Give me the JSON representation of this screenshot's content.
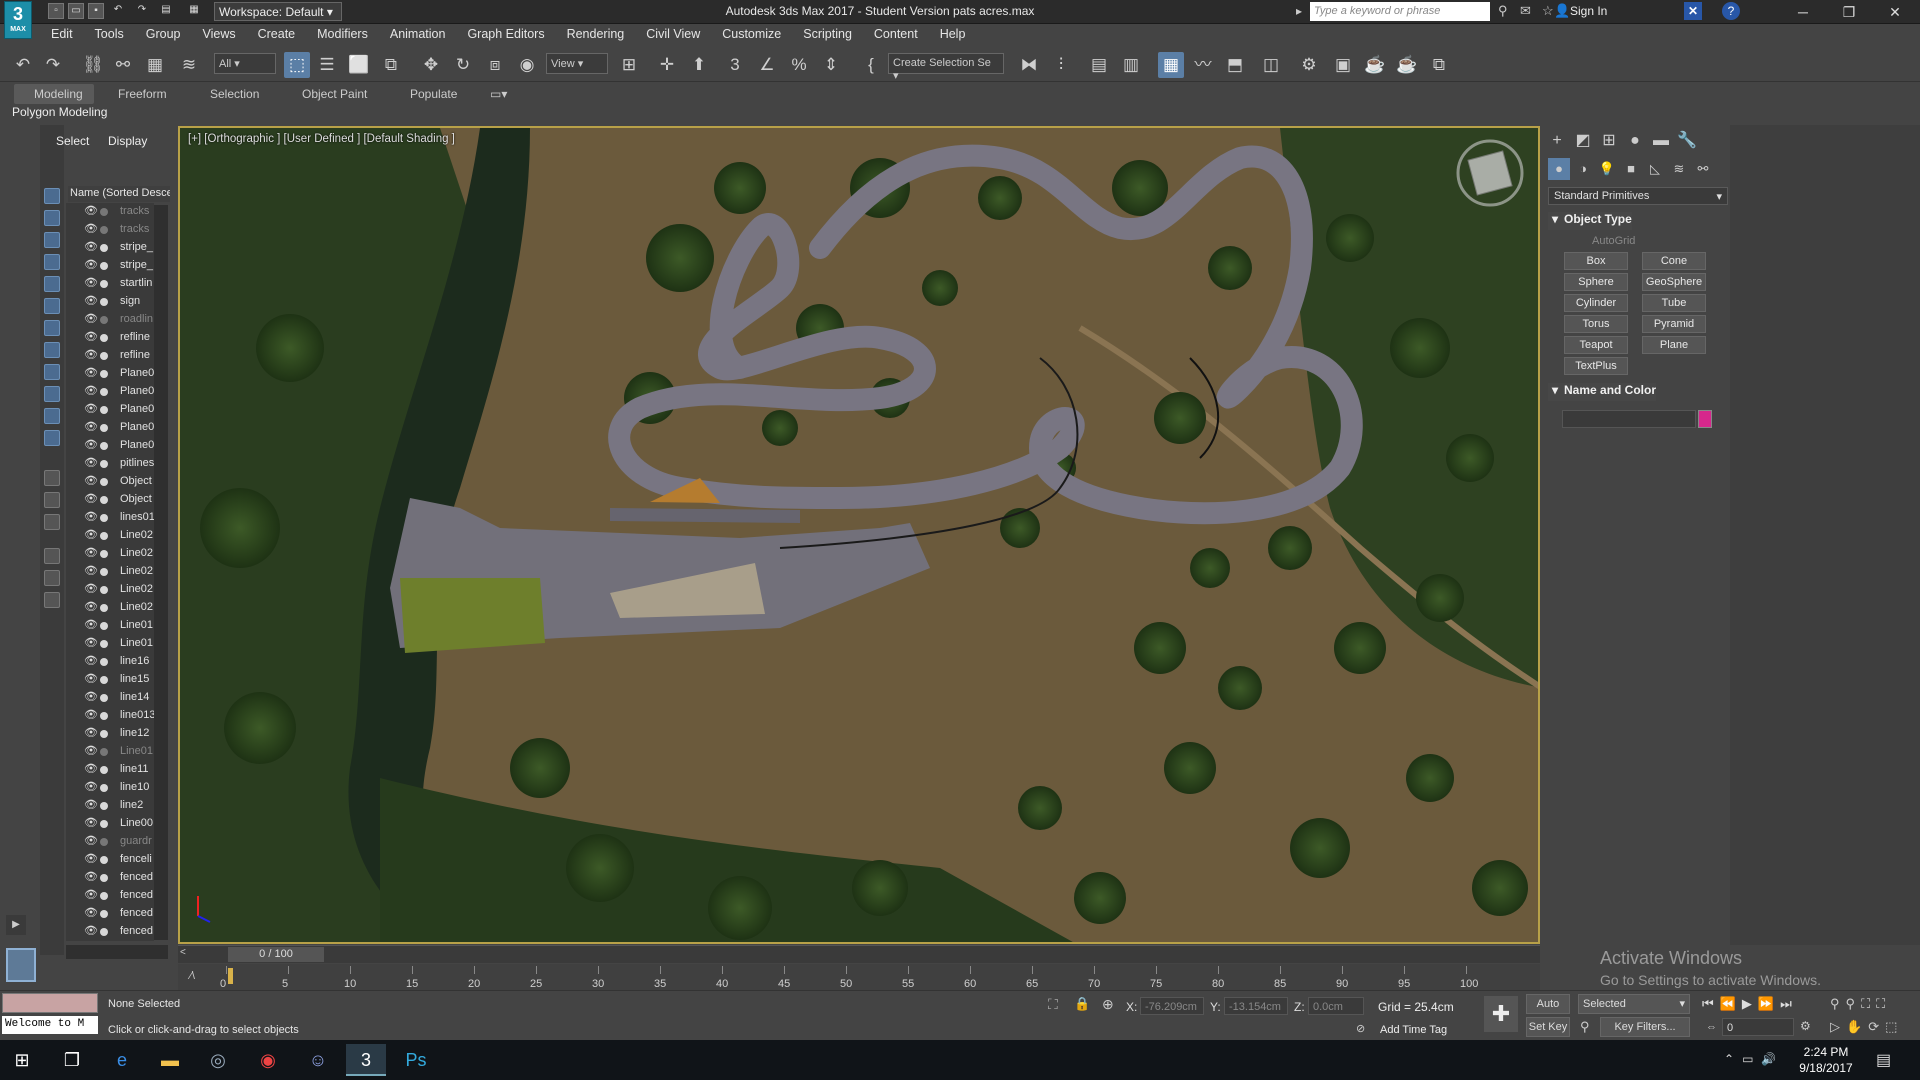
{
  "title_bar": {
    "logo_text": "3",
    "logo_sub": "MAX",
    "workspace": "Workspace: Default",
    "window_title": "Autodesk 3ds Max 2017 - Student Version    pats acres.max",
    "search_placeholder": "Type a keyword or phrase",
    "sign_in": "Sign In",
    "help": "?"
  },
  "menu": [
    "Edit",
    "Tools",
    "Group",
    "Views",
    "Create",
    "Modifiers",
    "Animation",
    "Graph Editors",
    "Rendering",
    "Civil View",
    "Customize",
    "Scripting",
    "Content",
    "Help"
  ],
  "toolbar": {
    "selection_filter": "All",
    "ref_coord": "View",
    "named_selection": "Create Selection Se"
  },
  "ribbon": {
    "tabs": [
      "Modeling",
      "Freeform",
      "Selection",
      "Object Paint",
      "Populate"
    ],
    "active": "Modeling",
    "sub_label": "Polygon Modeling"
  },
  "scene_explorer": {
    "tabs": [
      "Select",
      "Display"
    ],
    "column_header": "Name (Sorted Descen",
    "rows": [
      {
        "name": "tracks",
        "dim": true
      },
      {
        "name": "tracks",
        "dim": true
      },
      {
        "name": "stripe_",
        "dim": false
      },
      {
        "name": "stripe_",
        "dim": false
      },
      {
        "name": "startlin",
        "dim": false
      },
      {
        "name": "sign",
        "dim": false
      },
      {
        "name": "roadlin",
        "dim": true
      },
      {
        "name": "refline",
        "dim": false
      },
      {
        "name": "refline",
        "dim": false
      },
      {
        "name": "Plane0",
        "dim": false
      },
      {
        "name": "Plane0",
        "dim": false
      },
      {
        "name": "Plane0",
        "dim": false
      },
      {
        "name": "Plane0",
        "dim": false
      },
      {
        "name": "Plane0",
        "dim": false
      },
      {
        "name": "pitlines",
        "dim": false
      },
      {
        "name": "Object",
        "dim": false
      },
      {
        "name": "Object",
        "dim": false
      },
      {
        "name": "lines01",
        "dim": false
      },
      {
        "name": "Line02",
        "dim": false
      },
      {
        "name": "Line02",
        "dim": false
      },
      {
        "name": "Line02",
        "dim": false
      },
      {
        "name": "Line02",
        "dim": false
      },
      {
        "name": "Line02",
        "dim": false
      },
      {
        "name": "Line01",
        "dim": false
      },
      {
        "name": "Line01",
        "dim": false
      },
      {
        "name": "line16",
        "dim": false
      },
      {
        "name": "line15",
        "dim": false
      },
      {
        "name": "line14",
        "dim": false
      },
      {
        "name": "line013",
        "dim": false
      },
      {
        "name": "line12",
        "dim": false
      },
      {
        "name": "Line01",
        "dim": true
      },
      {
        "name": "line11",
        "dim": false
      },
      {
        "name": "line10",
        "dim": false
      },
      {
        "name": "line2",
        "dim": false
      },
      {
        "name": "Line00",
        "dim": false
      },
      {
        "name": "guardr",
        "dim": true
      },
      {
        "name": "fenceli",
        "dim": false
      },
      {
        "name": "fenced",
        "dim": false
      },
      {
        "name": "fenced",
        "dim": false
      },
      {
        "name": "fenced",
        "dim": false
      },
      {
        "name": "fenced",
        "dim": false
      }
    ]
  },
  "viewport": {
    "label": "[+] [Orthographic ] [User Defined ] [Default Shading ]"
  },
  "command_panel": {
    "dropdown": "Standard Primitives",
    "object_type_title": "Object Type",
    "autogrid": "AutoGrid",
    "buttons": [
      "Box",
      "Cone",
      "Sphere",
      "GeoSphere",
      "Cylinder",
      "Tube",
      "Torus",
      "Pyramid",
      "Teapot",
      "Plane",
      "TextPlus"
    ],
    "name_color_title": "Name and Color",
    "color": "#d6278c"
  },
  "watermark": {
    "line1": "Activate Windows",
    "line2": "Go to Settings to activate Windows."
  },
  "timeline": {
    "frame_counter": "0 / 100",
    "ticks": [
      "0",
      "5",
      "10",
      "15",
      "20",
      "25",
      "30",
      "35",
      "40",
      "45",
      "50",
      "55",
      "60",
      "65",
      "70",
      "75",
      "80",
      "85",
      "90",
      "95",
      "100"
    ]
  },
  "status": {
    "selection": "None Selected",
    "prompt": "Click or click-and-drag to select objects",
    "listener": "Welcome to M",
    "x_label": "X:",
    "x": "-76.209cm",
    "y_label": "Y:",
    "y": "-13.154cm",
    "z_label": "Z:",
    "z": "0.0cm",
    "grid": "Grid = 25.4cm",
    "add_time_tag": "Add Time Tag",
    "auto_key": "Auto Key",
    "set_key": "Set Key",
    "selected": "Selected",
    "key_filters": "Key Filters...",
    "frame": "0"
  },
  "taskbar": {
    "time": "2:24 PM",
    "date": "9/18/2017"
  }
}
